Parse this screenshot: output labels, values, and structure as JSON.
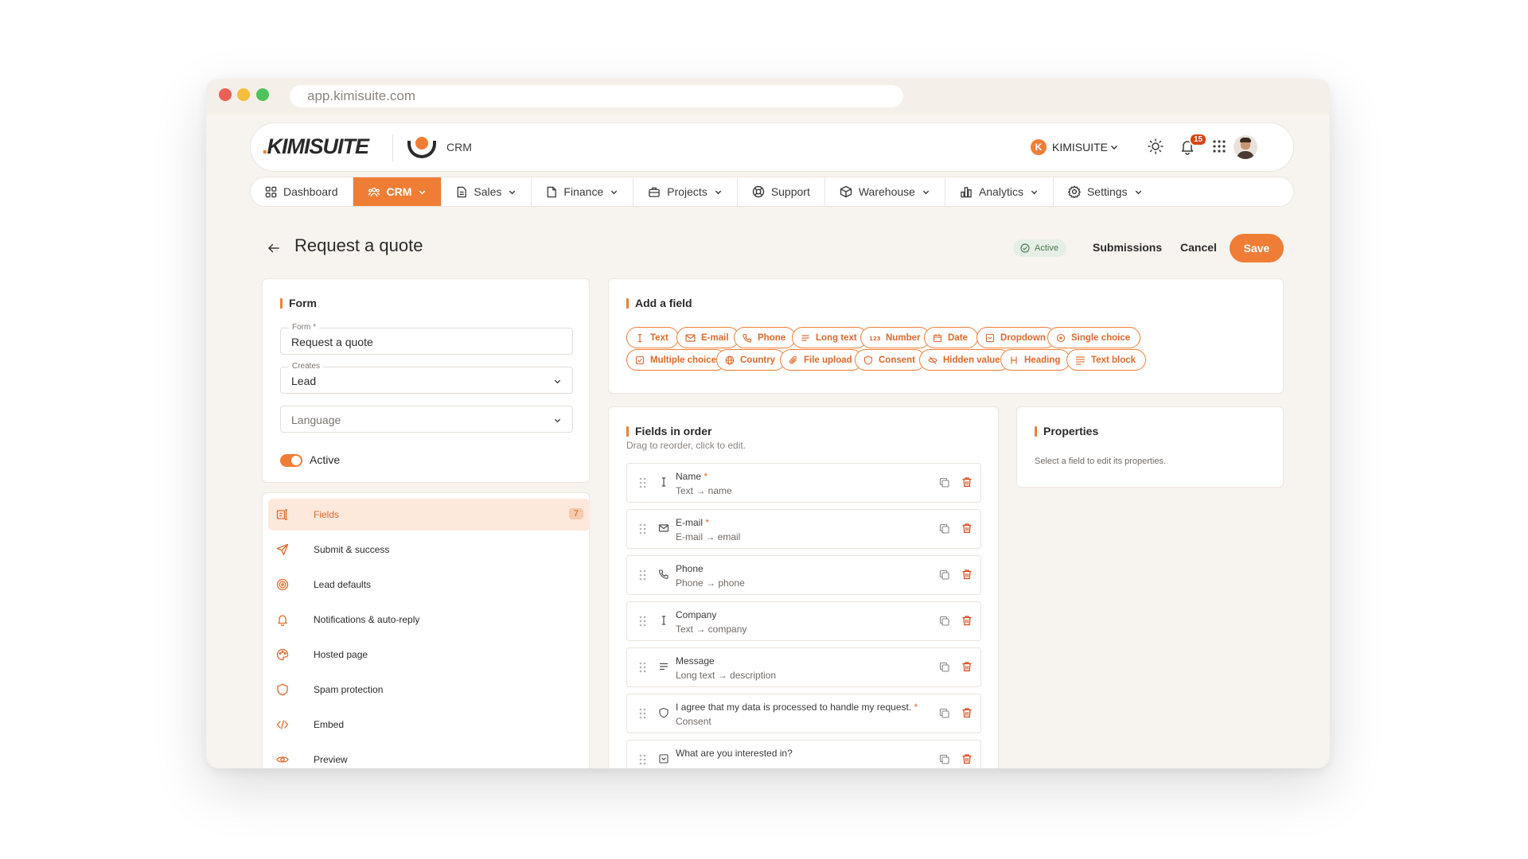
{
  "browser": {
    "url": "app.kimisuite.com"
  },
  "header": {
    "brand": "KIMISUITE",
    "module": "CRM",
    "org_initial": "K",
    "org_name": "KIMISUITE",
    "notifications": "15",
    "icons": [
      "sun-icon",
      "bell-icon",
      "apps-grid-icon",
      "avatar"
    ]
  },
  "nav": [
    {
      "label": "Dashboard",
      "icon": "dashboard-icon",
      "dropdown": false
    },
    {
      "label": "CRM",
      "icon": "users-icon",
      "dropdown": true,
      "active": true
    },
    {
      "label": "Sales",
      "icon": "document-icon",
      "dropdown": true
    },
    {
      "label": "Finance",
      "icon": "file-icon",
      "dropdown": true
    },
    {
      "label": "Projects",
      "icon": "briefcase-icon",
      "dropdown": true
    },
    {
      "label": "Support",
      "icon": "lifebuoy-icon",
      "dropdown": false
    },
    {
      "label": "Warehouse",
      "icon": "box-icon",
      "dropdown": true
    },
    {
      "label": "Analytics",
      "icon": "bar-chart-icon",
      "dropdown": true
    },
    {
      "label": "Settings",
      "icon": "gear-icon",
      "dropdown": true
    }
  ],
  "page": {
    "title": "Request a quote",
    "status": "Active",
    "submissions": "Submissions",
    "cancel": "Cancel",
    "save": "Save"
  },
  "form_card": {
    "title": "Form",
    "form_label": "Form *",
    "form_value": "Request a quote",
    "creates_label": "Creates",
    "creates_value": "Lead",
    "language_placeholder": "Language",
    "active_label": "Active",
    "active_on": true
  },
  "menu": [
    {
      "label": "Fields",
      "icon": "fields-icon",
      "count": "7",
      "active": true
    },
    {
      "label": "Submit & success",
      "icon": "send-icon"
    },
    {
      "label": "Lead defaults",
      "icon": "target-icon"
    },
    {
      "label": "Notifications & auto-reply",
      "icon": "bell-icon"
    },
    {
      "label": "Hosted page",
      "icon": "palette-icon"
    },
    {
      "label": "Spam protection",
      "icon": "shield-icon"
    },
    {
      "label": "Embed",
      "icon": "code-icon"
    },
    {
      "label": "Preview",
      "icon": "eye-icon"
    }
  ],
  "add_field": {
    "title": "Add a field",
    "types": [
      {
        "label": "Text",
        "icon": "text-cursor-icon"
      },
      {
        "label": "E-mail",
        "icon": "mail-icon"
      },
      {
        "label": "Phone",
        "icon": "phone-icon"
      },
      {
        "label": "Long text",
        "icon": "lines-icon"
      },
      {
        "label": "Number",
        "icon": "number-icon"
      },
      {
        "label": "Date",
        "icon": "calendar-icon"
      },
      {
        "label": "Dropdown",
        "icon": "dropdown-icon"
      },
      {
        "label": "Single choice",
        "icon": "radio-icon"
      },
      {
        "label": "Multiple choice",
        "icon": "checkbox-icon"
      },
      {
        "label": "Country",
        "icon": "globe-icon"
      },
      {
        "label": "File upload",
        "icon": "paperclip-icon"
      },
      {
        "label": "Consent",
        "icon": "shield-icon"
      },
      {
        "label": "Hidden value",
        "icon": "eye-off-icon"
      },
      {
        "label": "Heading",
        "icon": "heading-icon"
      },
      {
        "label": "Text block",
        "icon": "text-block-icon"
      }
    ]
  },
  "fields_in_order": {
    "title": "Fields in order",
    "subtitle": "Drag to reorder, click to edit.",
    "items": [
      {
        "name": "Name",
        "required": true,
        "mapping": "Text → name",
        "icon": "text-cursor-icon"
      },
      {
        "name": "E-mail",
        "required": true,
        "mapping": "E-mail → email",
        "icon": "mail-icon"
      },
      {
        "name": "Phone",
        "required": false,
        "mapping": "Phone → phone",
        "icon": "phone-icon"
      },
      {
        "name": "Company",
        "required": false,
        "mapping": "Text → company",
        "icon": "text-cursor-icon"
      },
      {
        "name": "Message",
        "required": false,
        "mapping": "Long text → description",
        "icon": "lines-icon"
      },
      {
        "name": "I agree that my data is processed to handle my request.",
        "required": true,
        "mapping": "Consent",
        "icon": "shield-icon"
      },
      {
        "name": "What are you interested in?",
        "required": false,
        "mapping": "",
        "icon": "dropdown-icon"
      }
    ]
  },
  "properties": {
    "title": "Properties",
    "hint": "Select a field to edit its properties."
  },
  "colors": {
    "accent": "#f07d35",
    "background": "#f7f3ee",
    "active_status": "#4b7a4f"
  }
}
